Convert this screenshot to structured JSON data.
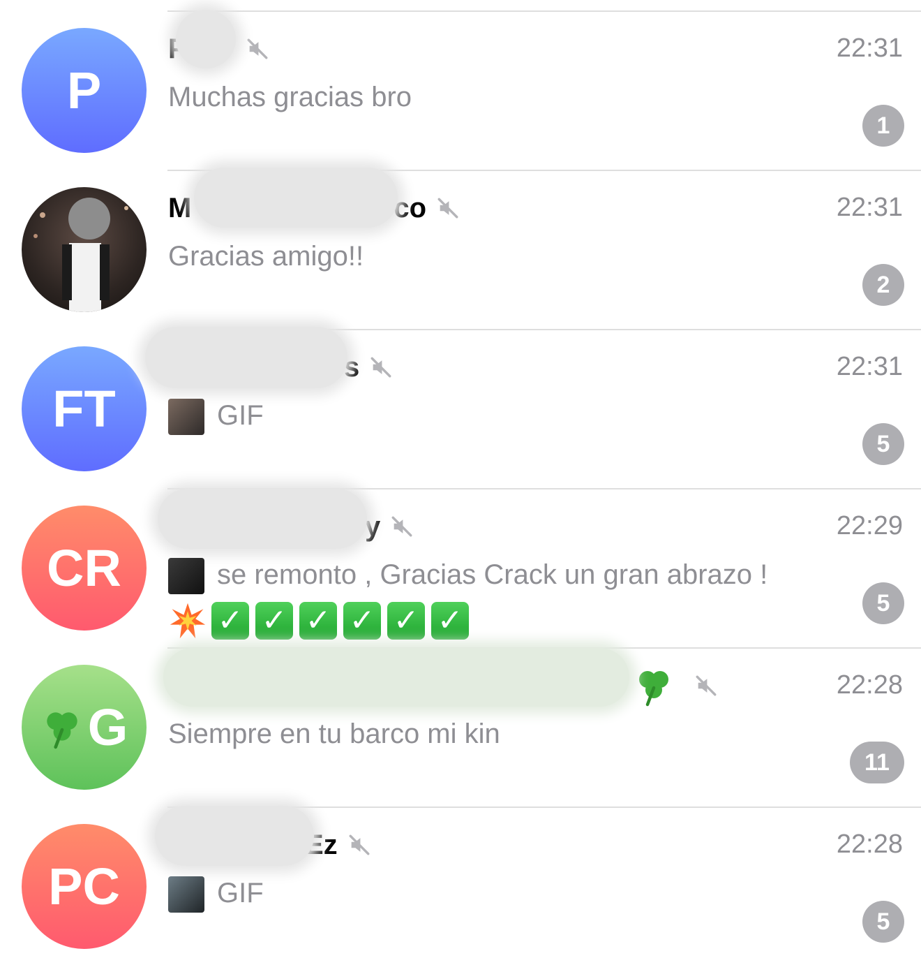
{
  "chats": [
    {
      "avatar_initials": "P",
      "avatar_style": "blue",
      "name": "P",
      "muted": true,
      "time": "22:31",
      "message": "Muchas gracias bro",
      "unread": "1"
    },
    {
      "avatar_initials": "",
      "avatar_style": "photo",
      "name_prefix": "M",
      "name_suffix": "co",
      "muted": true,
      "time": "22:31",
      "message": "Gracias amigo!!",
      "unread": "2"
    },
    {
      "avatar_initials": "FT",
      "avatar_style": "blue",
      "name_suffix": "s",
      "muted": true,
      "time": "22:31",
      "message": "GIF",
      "has_thumbnail": true,
      "unread": "5"
    },
    {
      "avatar_initials": "CR",
      "avatar_style": "red",
      "name_suffix": "y",
      "muted": true,
      "time": "22:29",
      "message": "se remonto , Gracias Crack un gran abrazo !",
      "message_emoji_line": "💥✅✅✅✅✅✅",
      "has_thumbnail": true,
      "unread": "5"
    },
    {
      "avatar_initials": "G",
      "avatar_emoji": "☘️",
      "avatar_style": "green",
      "name_suffix": "☘️",
      "muted": true,
      "time": "22:28",
      "message": "Siempre en tu barco mi kin",
      "unread": "11"
    },
    {
      "avatar_initials": "PC",
      "avatar_style": "red",
      "name_suffix": "Ez",
      "muted": true,
      "time": "22:28",
      "message": "GIF",
      "has_thumbnail": true,
      "unread": "5"
    }
  ],
  "icons": {
    "mute": "speaker-muted-icon"
  },
  "colors": {
    "badge": "#aeaeb2",
    "secondary_text": "#8e8e93",
    "avatar_blue": "#6a7dff",
    "avatar_red": "#ff6a6b",
    "avatar_green": "#79cf6c"
  }
}
